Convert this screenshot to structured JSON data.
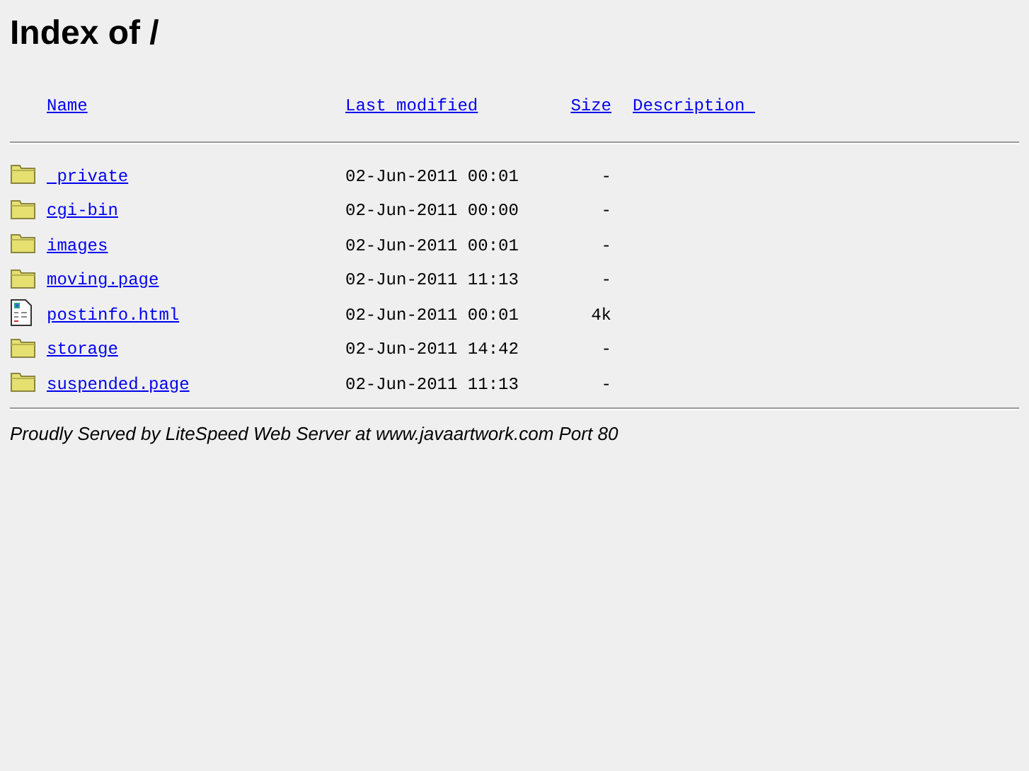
{
  "title": "Index of /",
  "columns": [
    "Name",
    "Last modified",
    "Size",
    "Description "
  ],
  "rows": [
    {
      "kind": "folder",
      "name": " private",
      "modified": "02-Jun-2011 00:01",
      "size": "-"
    },
    {
      "kind": "folder",
      "name": "cgi-bin",
      "modified": "02-Jun-2011 00:00",
      "size": "-"
    },
    {
      "kind": "folder",
      "name": "images",
      "modified": "02-Jun-2011 00:01",
      "size": "-"
    },
    {
      "kind": "folder",
      "name": "moving.page",
      "modified": "02-Jun-2011 11:13",
      "size": "-"
    },
    {
      "kind": "file",
      "name": "postinfo.html",
      "modified": "02-Jun-2011 00:01",
      "size": "4k"
    },
    {
      "kind": "folder",
      "name": "storage",
      "modified": "02-Jun-2011 14:42",
      "size": "-"
    },
    {
      "kind": "folder",
      "name": "suspended.page",
      "modified": "02-Jun-2011 11:13",
      "size": "-"
    }
  ],
  "footer": "Proudly Served by LiteSpeed Web Server at www.javaartwork.com Port 80"
}
